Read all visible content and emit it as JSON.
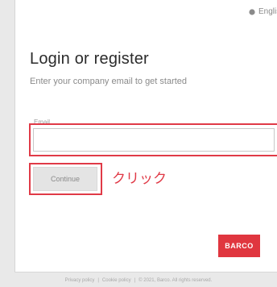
{
  "header": {
    "language_label": "English"
  },
  "login": {
    "title": "Login or register",
    "subtitle": "Enter your company email to get started",
    "email_label": "Email",
    "email_value": "",
    "continue_label": "Continue"
  },
  "annotation": {
    "click_text": "クリック",
    "highlight_color": "#e03a47"
  },
  "brand": {
    "logo_text": "BARCO",
    "logo_color": "#e0363f"
  },
  "footer": {
    "privacy": "Privacy policy",
    "separator": "|",
    "cookie": "Cookie policy",
    "copyright": "© 2021, Barco. All rights reserved."
  },
  "icons": {
    "language": "globe-icon"
  }
}
